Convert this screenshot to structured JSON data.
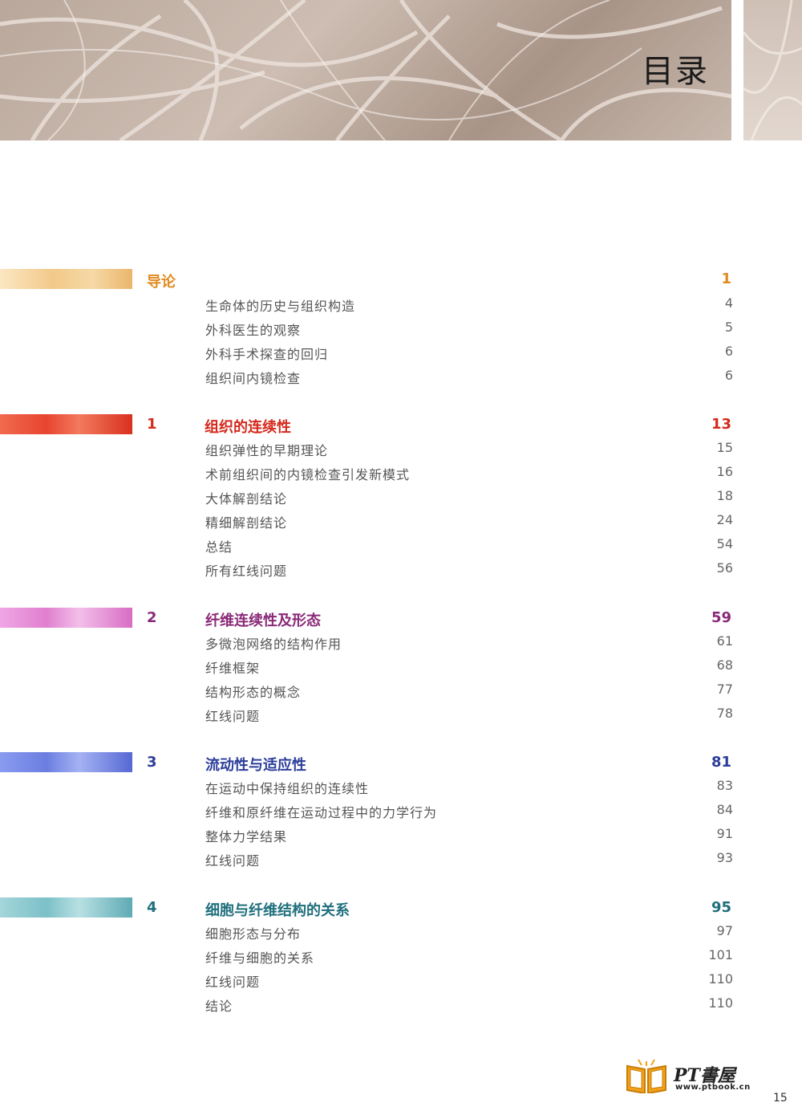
{
  "page_title": "目录",
  "toc": [
    {
      "num": "",
      "title": "导论",
      "page": "1",
      "color": "#e08a1e",
      "entries": [
        {
          "title": "生命体的历史与组织构造",
          "page": "4"
        },
        {
          "title": "外科医生的观察",
          "page": "5"
        },
        {
          "title": "外科手术探查的回归",
          "page": "6"
        },
        {
          "title": "组织间内镜检查",
          "page": "6"
        }
      ]
    },
    {
      "num": "1",
      "title": "组织的连续性",
      "page": "13",
      "color": "#d42a1c",
      "entries": [
        {
          "title": "组织弹性的早期理论",
          "page": "15"
        },
        {
          "title": "术前组织间的内镜检查引发新模式",
          "page": "16"
        },
        {
          "title": "大体解剖结论",
          "page": "18"
        },
        {
          "title": "精细解剖结论",
          "page": "24"
        },
        {
          "title": "总结",
          "page": "54"
        },
        {
          "title": "所有红线问题",
          "page": "56"
        }
      ]
    },
    {
      "num": "2",
      "title": "纤维连续性及形态",
      "page": "59",
      "color": "#8a2a78",
      "entries": [
        {
          "title": "多微泡网络的结构作用",
          "page": "61"
        },
        {
          "title": "纤维框架",
          "page": "68"
        },
        {
          "title": "结构形态的概念",
          "page": "77"
        },
        {
          "title": "红线问题",
          "page": "78"
        }
      ]
    },
    {
      "num": "3",
      "title": "流动性与适应性",
      "page": "81",
      "color": "#2b3d9a",
      "entries": [
        {
          "title": "在运动中保持组织的连续性",
          "page": "83"
        },
        {
          "title": "纤维和原纤维在运动过程中的力学行为",
          "page": "84"
        },
        {
          "title": "整体力学结果",
          "page": "91"
        },
        {
          "title": "红线问题",
          "page": "93"
        }
      ]
    },
    {
      "num": "4",
      "title": "细胞与纤维结构的关系",
      "page": "95",
      "color": "#1f6f7d",
      "entries": [
        {
          "title": "细胞形态与分布",
          "page": "97"
        },
        {
          "title": "纤维与细胞的关系",
          "page": "101"
        },
        {
          "title": "红线问题",
          "page": "110"
        },
        {
          "title": "结论",
          "page": "110"
        }
      ]
    }
  ],
  "bar_colors": [
    "#f2c98a",
    "#e8452f",
    "#e07fcf",
    "#6b7ee0",
    "#7cc0c8"
  ],
  "logo": {
    "title": "PT書屋",
    "url": "www.ptbook.cn"
  },
  "page_number": "15"
}
